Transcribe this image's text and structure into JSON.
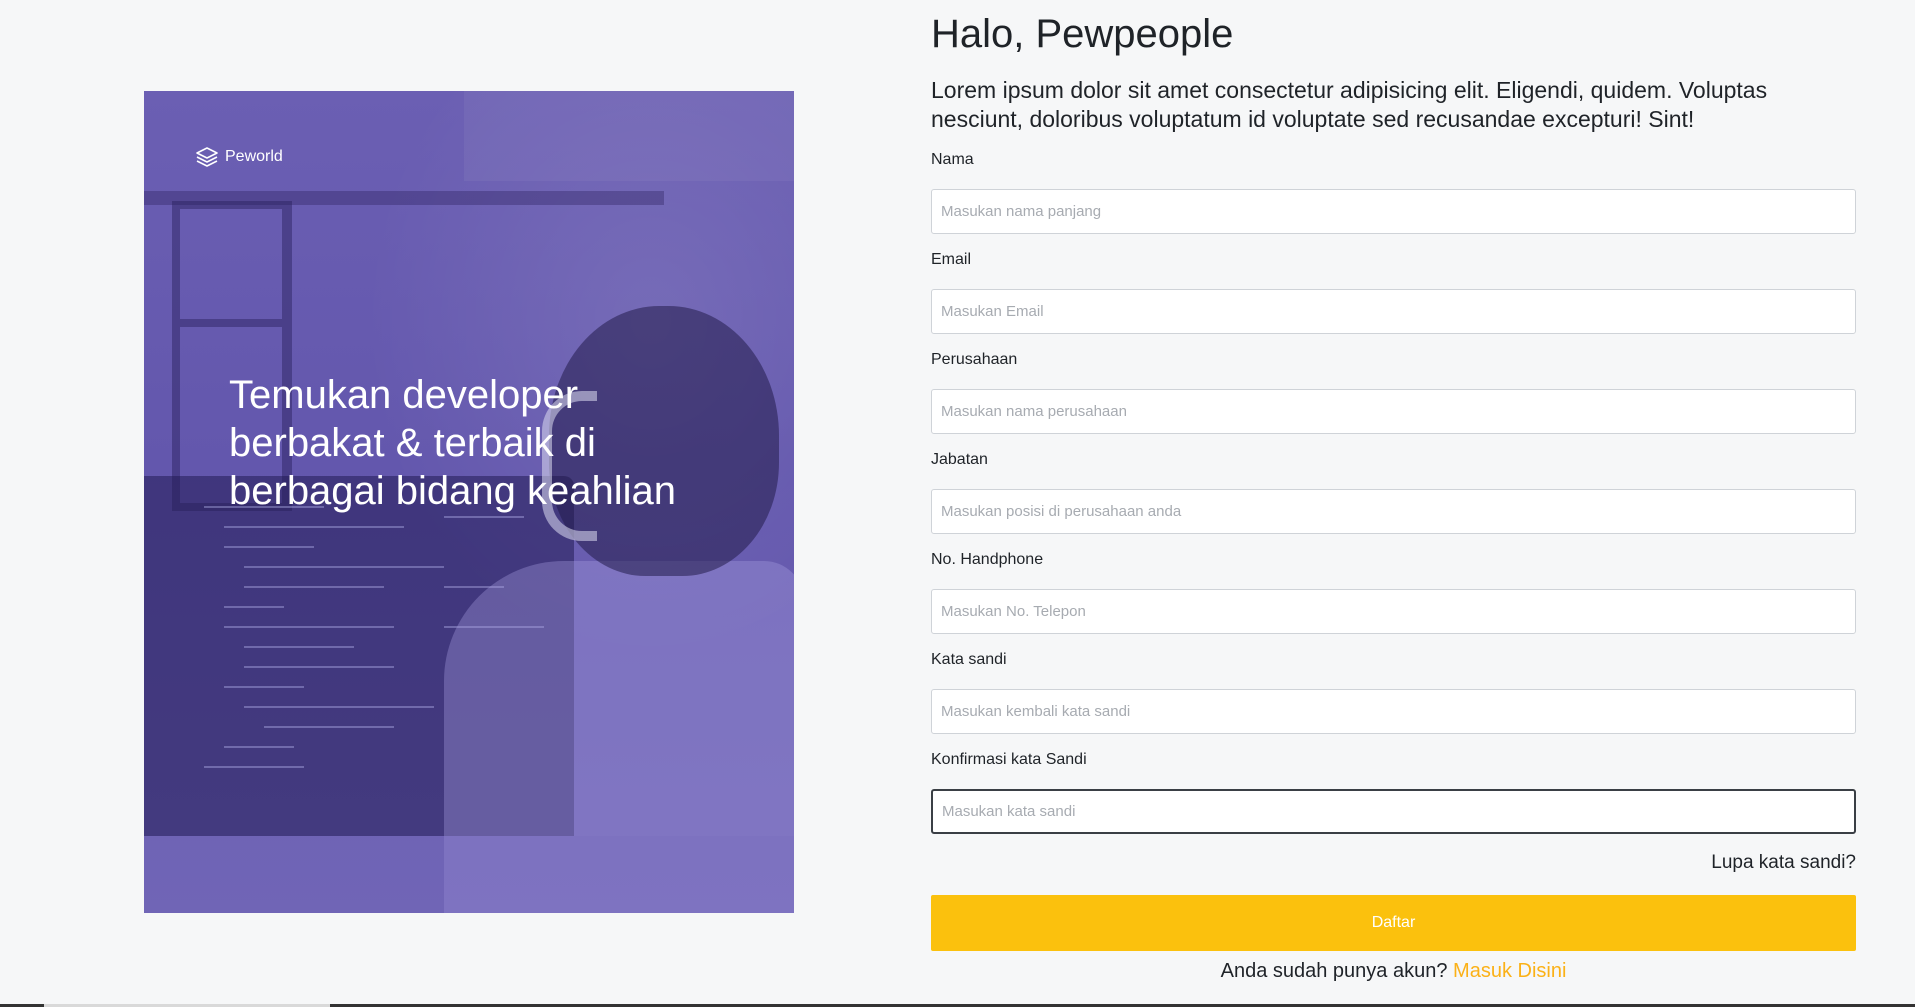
{
  "hero": {
    "brand_name": "Peworld",
    "brand_icon": "stacked-layers-icon",
    "headline": "Temukan developer berbakat & terbaik di berbagai bidang keahlian",
    "overlay_color": "#6b5fb3"
  },
  "form": {
    "greeting": "Halo, Pewpeople",
    "intro": "Lorem ipsum dolor sit amet consectetur adipisicing elit. Eligendi, quidem. Voluptas nesciunt, doloribus voluptatum id voluptate sed recusandae excepturi! Sint!",
    "fields": [
      {
        "label": "Nama",
        "placeholder": "Masukan nama panjang",
        "value": ""
      },
      {
        "label": "Email",
        "placeholder": "Masukan Email",
        "value": ""
      },
      {
        "label": "Perusahaan",
        "placeholder": "Masukan nama perusahaan",
        "value": ""
      },
      {
        "label": "Jabatan",
        "placeholder": "Masukan posisi di perusahaan anda",
        "value": ""
      },
      {
        "label": "No. Handphone",
        "placeholder": "Masukan No. Telepon",
        "value": ""
      },
      {
        "label": "Kata sandi",
        "placeholder": "Masukan kembali kata sandi",
        "value": ""
      },
      {
        "label": "Konfirmasi kata Sandi",
        "placeholder": "Masukan kata sandi",
        "value": ""
      }
    ],
    "forgot_password": "Lupa kata sandi?",
    "submit_label": "Daftar",
    "signin_prompt": "Anda sudah punya akun?",
    "signin_link": "Masuk Disini"
  },
  "colors": {
    "accent": "#fbc10d",
    "link": "#fbb117",
    "background": "#f6f7f8"
  }
}
